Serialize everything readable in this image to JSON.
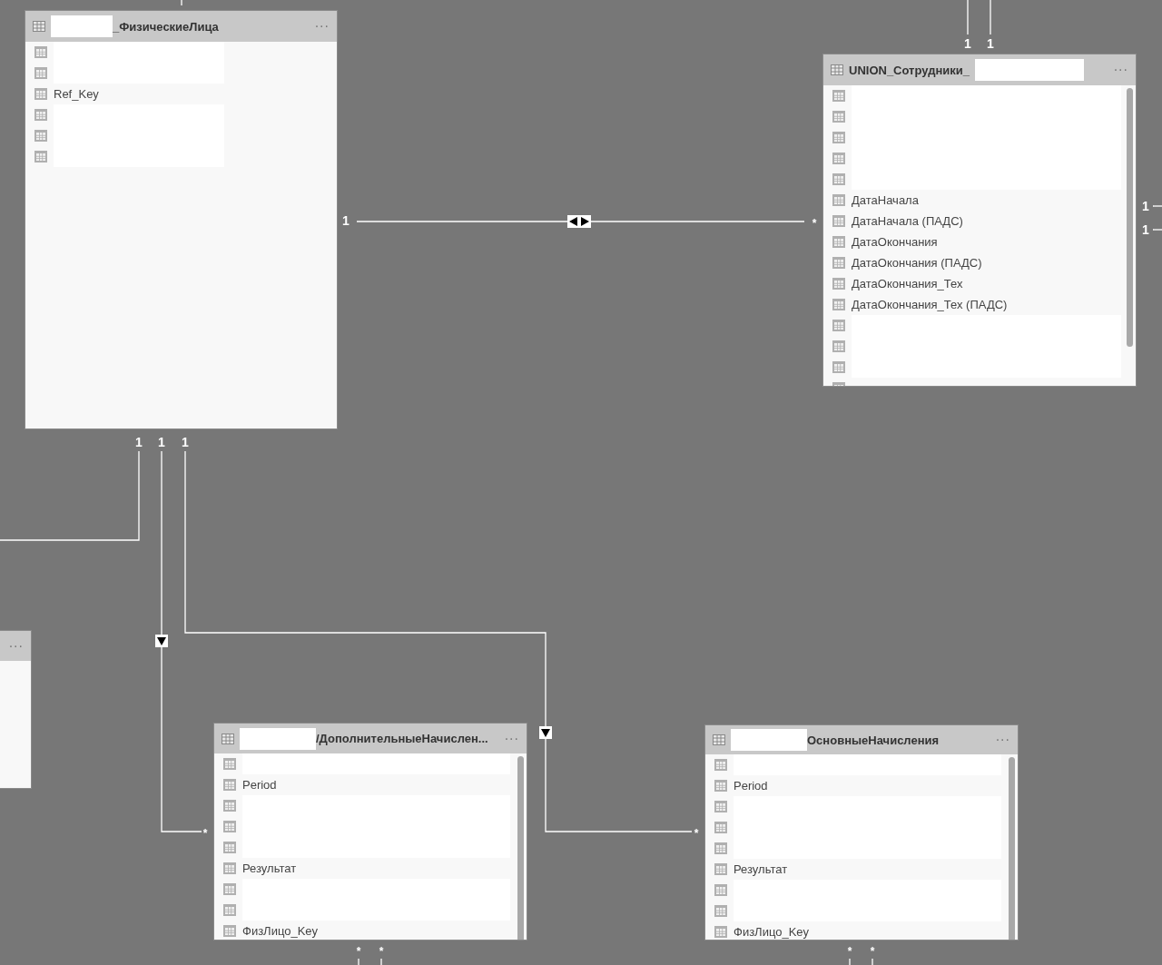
{
  "tables": [
    {
      "title": "_ФизическиеЛица",
      "kind": "redacted_start",
      "menu": "···",
      "fields": [
        {
          "redacted": true
        },
        {
          "redacted": true
        },
        {
          "name": "Ref_Key",
          "redacted": false
        },
        {
          "redacted": true
        },
        {
          "redacted": true
        },
        {
          "redacted": true
        }
      ]
    },
    {
      "title": "UNION_Сотрудники_",
      "kind": "redacted_end",
      "menu": "···",
      "fields": [
        {
          "redacted": true
        },
        {
          "redacted": true
        },
        {
          "redacted": true
        },
        {
          "redacted": true
        },
        {
          "redacted": true
        },
        {
          "name": "ДатаНачала",
          "redacted": false
        },
        {
          "name": "ДатаНачала (ПАДС)",
          "redacted": false
        },
        {
          "name": "ДатаОкончания",
          "redacted": false
        },
        {
          "name": "ДатаОкончания (ПАДС)",
          "redacted": false
        },
        {
          "name": "ДатаОкончания_Тех",
          "redacted": false
        },
        {
          "name": "ДатаОкончания_Тех (ПАДС)",
          "redacted": false
        },
        {
          "redacted": true
        },
        {
          "redacted": true
        },
        {
          "redacted": true
        },
        {
          "redacted": false
        }
      ]
    },
    {
      "title": "/ДополнительныеНачислен...",
      "kind": "redacted_start",
      "menu": "···",
      "fields": [
        {
          "redacted": true
        },
        {
          "name": "Period",
          "redacted": false
        },
        {
          "redacted": true
        },
        {
          "redacted": true
        },
        {
          "redacted": true
        },
        {
          "name": "Результат",
          "redacted": false
        },
        {
          "redacted": true
        },
        {
          "redacted": true
        },
        {
          "name": "ФизЛицо_Key",
          "redacted": false
        }
      ]
    },
    {
      "title": "ОсновныеНачисления",
      "kind": "redacted_start",
      "menu": "···",
      "fields": [
        {
          "redacted": true
        },
        {
          "name": "Period",
          "redacted": false
        },
        {
          "redacted": true
        },
        {
          "redacted": true
        },
        {
          "redacted": true
        },
        {
          "name": "Результат",
          "redacted": false
        },
        {
          "redacted": true
        },
        {
          "redacted": true
        },
        {
          "name": "ФизЛицо_Key",
          "redacted": false
        }
      ]
    },
    {
      "menu": "···"
    }
  ],
  "relationships": [
    {
      "from_card": "1",
      "kind": "none"
    },
    {
      "from_card": "1",
      "to_card": "*",
      "kind": "single"
    },
    {
      "from_card": "1",
      "to_card": "*",
      "kind": "single"
    },
    {
      "from_card": "1",
      "to_card": "*",
      "kind": "both"
    }
  ],
  "stubs": [
    {
      "card": "1"
    },
    {
      "card": "1"
    },
    {
      "card": "1"
    },
    {
      "card": "1"
    },
    {
      "card": "*"
    },
    {
      "card": "*"
    },
    {
      "card": "*"
    },
    {
      "card": "*"
    }
  ]
}
